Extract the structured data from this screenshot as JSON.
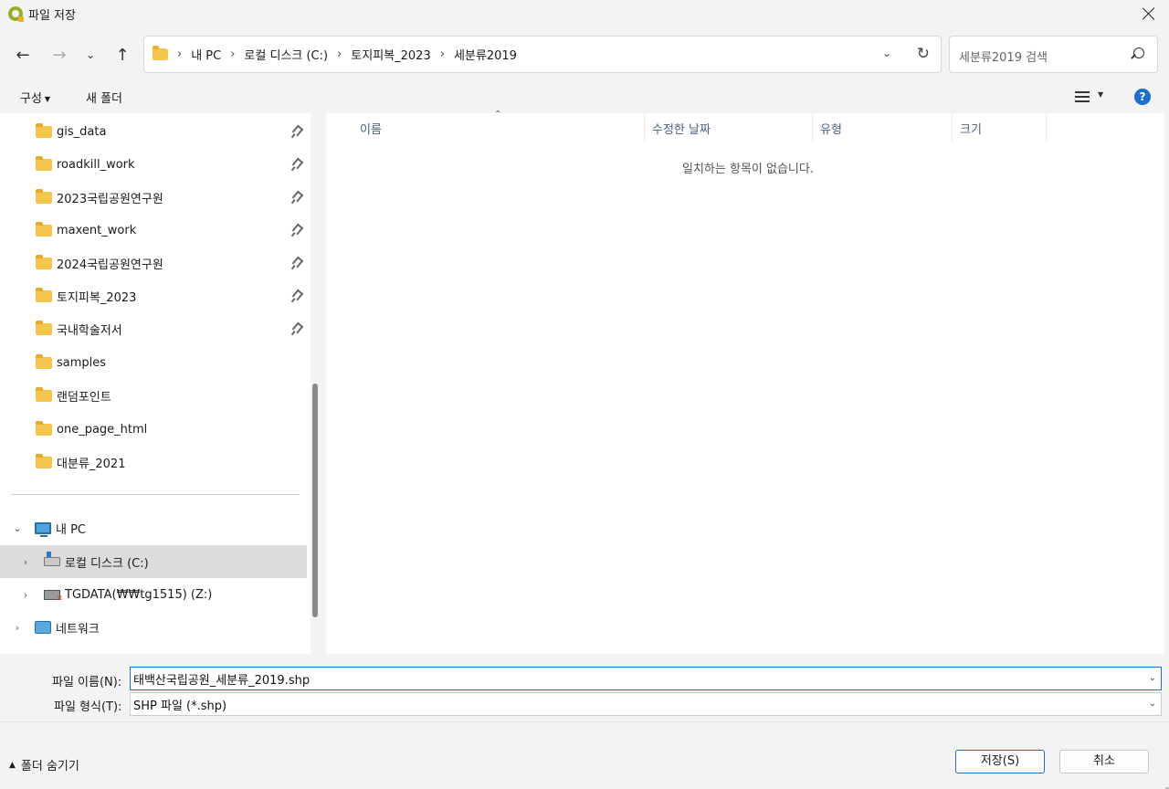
{
  "window": {
    "title": "파일 저장"
  },
  "address": {
    "crumbs": [
      "내 PC",
      "로컬 디스크 (C:)",
      "토지피복_2023",
      "세분류2019"
    ]
  },
  "search": {
    "placeholder": "세분류2019 검색"
  },
  "toolbar": {
    "organize": "구성",
    "new_folder": "새 폴더"
  },
  "sidebar": {
    "quick": [
      "gis_data",
      "roadkill_work",
      "2023국립공원연구원",
      "maxent_work",
      "2024국립공원연구원",
      "토지피복_2023",
      "국내학술저서",
      "samples",
      "랜덤포인트",
      "one_page_html",
      "대분류_2021"
    ],
    "pinned_count": 7,
    "this_pc": "내 PC",
    "local_disk": "로컬 디스크 (C:)",
    "net_drive": "TGDATA(₩₩tg1515) (Z:)",
    "network": "네트워크"
  },
  "columns": {
    "name": "이름",
    "modified": "수정한 날짜",
    "type": "유형",
    "size": "크기"
  },
  "content": {
    "empty": "일치하는 항목이 없습니다."
  },
  "form": {
    "filename_label": "파일 이름(N):",
    "filename_value": "태백산국립공원_세분류_2019.shp",
    "filetype_label": "파일 형식(T):",
    "filetype_value": "SHP 파일 (*.shp)"
  },
  "footer": {
    "hide_folders": "폴더 숨기기",
    "save": "저장(S)",
    "cancel": "취소"
  }
}
